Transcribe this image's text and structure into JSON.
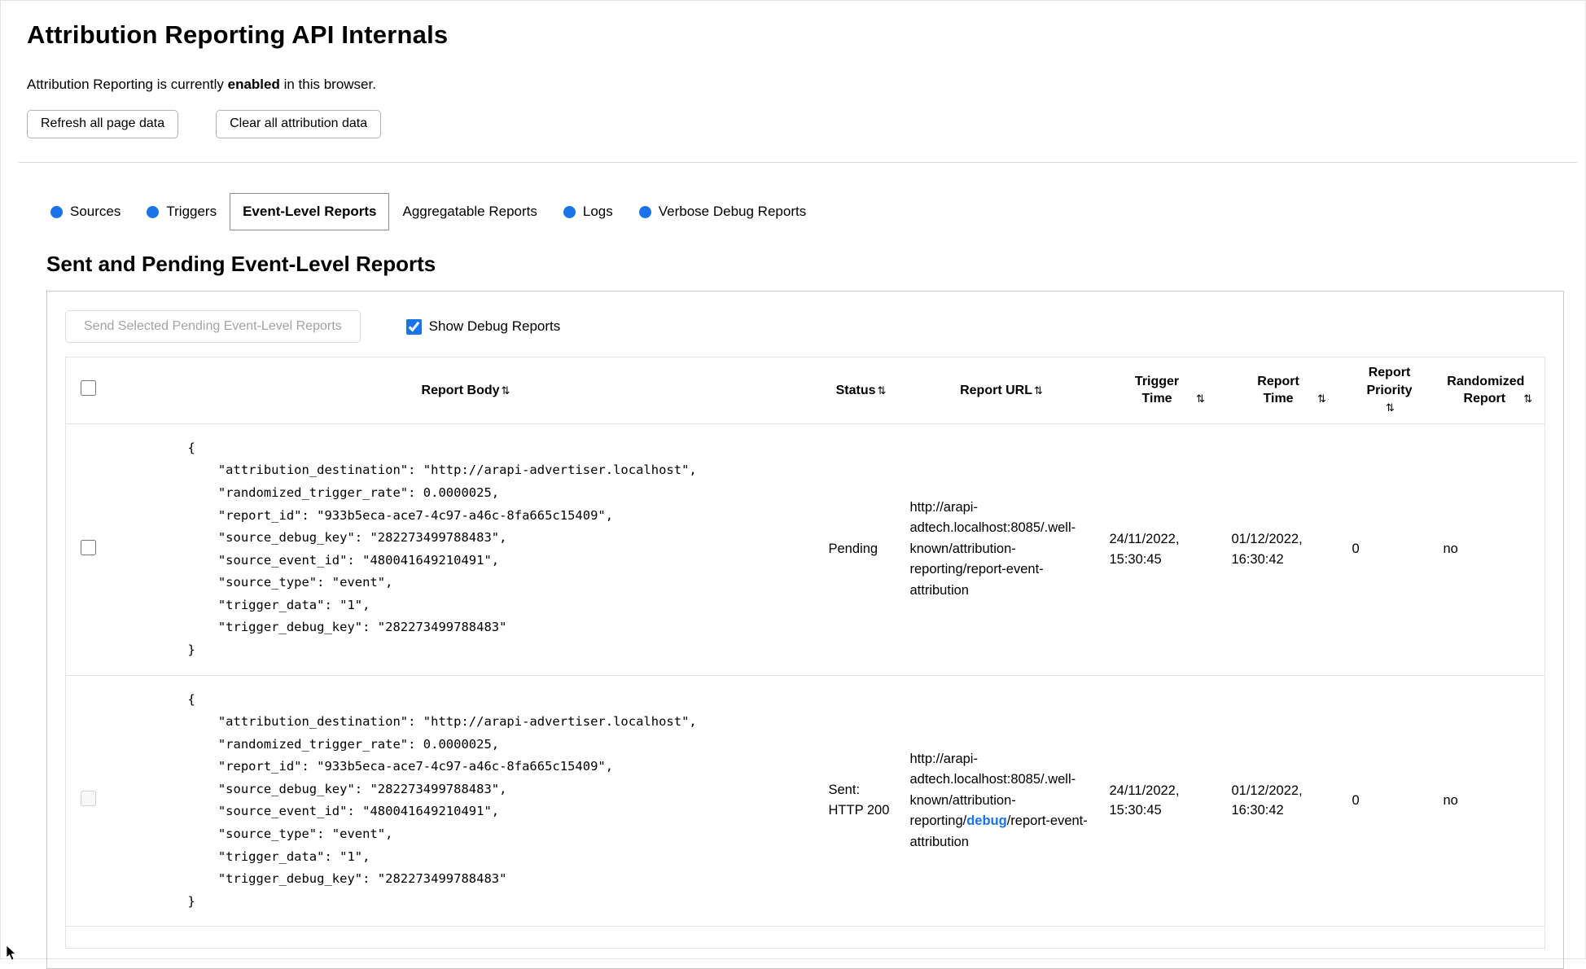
{
  "page": {
    "title": "Attribution Reporting API Internals",
    "status": {
      "prefix": "Attribution Reporting is currently ",
      "emphasis": "enabled",
      "suffix": " in this browser."
    },
    "buttons": {
      "refresh": "Refresh all page data",
      "clear": "Clear all attribution data"
    }
  },
  "tabs": [
    {
      "label": "Sources",
      "has_dot": true,
      "active": false
    },
    {
      "label": "Triggers",
      "has_dot": true,
      "active": false
    },
    {
      "label": "Event-Level Reports",
      "has_dot": false,
      "active": true
    },
    {
      "label": "Aggregatable Reports",
      "has_dot": false,
      "active": false
    },
    {
      "label": "Logs",
      "has_dot": true,
      "active": false
    },
    {
      "label": "Verbose Debug Reports",
      "has_dot": true,
      "active": false
    }
  ],
  "section": {
    "heading": "Sent and Pending Event-Level Reports",
    "send_button_label": "Send Selected Pending Event-Level Reports",
    "send_button_disabled": true,
    "show_debug_label": "Show Debug Reports",
    "show_debug_checked": true
  },
  "table": {
    "sort_icon": "⇅",
    "headers": [
      "Report Body",
      "Status",
      "Report URL",
      "Trigger Time",
      "Report Time",
      "Report Priority",
      "Randomized Report"
    ],
    "rows": [
      {
        "body": "{\n    \"attribution_destination\": \"http://arapi-advertiser.localhost\",\n    \"randomized_trigger_rate\": 0.0000025,\n    \"report_id\": \"933b5eca-ace7-4c97-a46c-8fa665c15409\",\n    \"source_debug_key\": \"282273499788483\",\n    \"source_event_id\": \"480041649210491\",\n    \"source_type\": \"event\",\n    \"trigger_data\": \"1\",\n    \"trigger_debug_key\": \"282273499788483\"\n}",
        "status": "Pending",
        "url_prefix": "http://arapi-adtech.localhost:8085/.well-known/attribution-reporting/report-event-attribution",
        "url_debug": "",
        "url_suffix": "",
        "trigger_time": "24/11/2022, 15:30:45",
        "report_time": "01/12/2022, 16:30:42",
        "report_priority": "0",
        "randomized_report": "no",
        "checkbox_disabled": false
      },
      {
        "body": "{\n    \"attribution_destination\": \"http://arapi-advertiser.localhost\",\n    \"randomized_trigger_rate\": 0.0000025,\n    \"report_id\": \"933b5eca-ace7-4c97-a46c-8fa665c15409\",\n    \"source_debug_key\": \"282273499788483\",\n    \"source_event_id\": \"480041649210491\",\n    \"source_type\": \"event\",\n    \"trigger_data\": \"1\",\n    \"trigger_debug_key\": \"282273499788483\"\n}",
        "status": "Sent: HTTP 200",
        "url_prefix": "http://arapi-adtech.localhost:8085/.well-known/attribution-reporting/",
        "url_debug": "debug",
        "url_suffix": "/report-event-attribution",
        "trigger_time": "24/11/2022, 15:30:45",
        "report_time": "01/12/2022, 16:30:42",
        "report_priority": "0",
        "randomized_report": "no",
        "checkbox_disabled": true
      }
    ]
  },
  "colors": {
    "accent_blue": "#1a73e8"
  }
}
